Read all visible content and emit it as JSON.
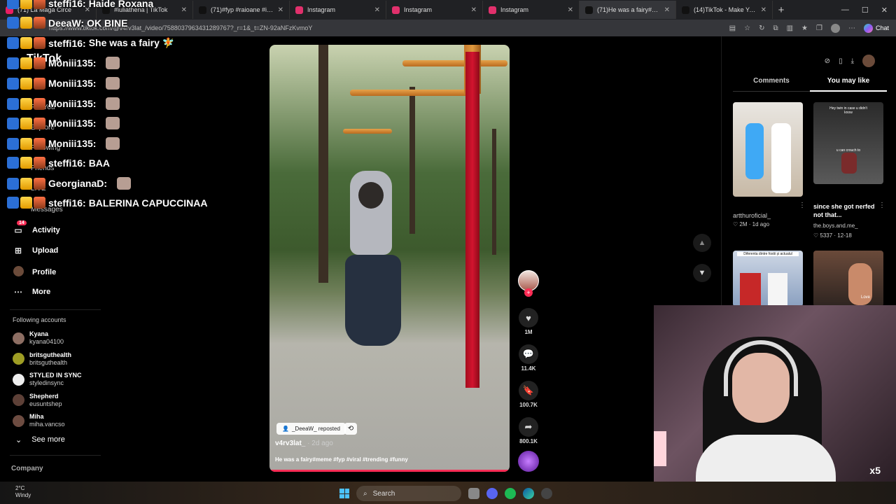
{
  "browser": {
    "tabs": [
      {
        "title": "(71) La Maga Circe",
        "color": "#e91e63"
      },
      {
        "title": "#iuliathena | TikTok",
        "color": "#111111"
      },
      {
        "title": "(71)#fyp #raioane #iulianab",
        "color": "#111111"
      },
      {
        "title": "Instagram",
        "color": "#e1306c"
      },
      {
        "title": "Instagram",
        "color": "#e1306c"
      },
      {
        "title": "Instagram",
        "color": "#e1306c"
      },
      {
        "title": "(71)He was a fairy#meme",
        "color": "#111111",
        "active": true
      },
      {
        "title": "(14)TikTok - Make Your",
        "color": "#111111"
      }
    ],
    "url": "https://www.tiktok.com/@v4rv3lat_/video/7588037963431289767?_r=1&_t=ZN-92aNFzKvmoY",
    "chat_label": "Chat"
  },
  "sidebar": {
    "logo": "TikTok",
    "faint_items": [
      "For You",
      "Explore",
      "Following",
      "Friends",
      "LIVE",
      "Messages"
    ],
    "items": [
      {
        "label": "Activity",
        "icon": "activity-icon",
        "badge": "14"
      },
      {
        "label": "Upload",
        "icon": "upload-icon"
      },
      {
        "label": "Profile",
        "icon": "profile-icon"
      },
      {
        "label": "More",
        "icon": "more-icon"
      }
    ],
    "following_heading": "Following accounts",
    "accounts": [
      {
        "name": "Kyana",
        "handle": "kyana04100",
        "color": "#8d6e63"
      },
      {
        "name": "britsguthealth",
        "handle": "britsguthealth",
        "color": "#9e9d24"
      },
      {
        "name": "STYLED IN SYNC",
        "handle": "styledinsync",
        "color": "#eeeeee"
      },
      {
        "name": "Shepherd",
        "handle": "eusuntshep",
        "color": "#5d4037"
      },
      {
        "name": "Miha",
        "handle": "miha.vancso",
        "color": "#6d4c41"
      }
    ],
    "see_more": "See more",
    "company": "Company"
  },
  "chat": [
    {
      "user": "steffi16:",
      "msg": "Haide Roxana"
    },
    {
      "user": "DeeaW:",
      "msg": "OK BINE"
    },
    {
      "user": "steffi16:",
      "msg": "She was a fairy 🧚"
    },
    {
      "user": "Moniii135:",
      "msg": "",
      "emote": true
    },
    {
      "user": "Moniii135:",
      "msg": "",
      "emote": true
    },
    {
      "user": "Moniii135:",
      "msg": "",
      "emote": true
    },
    {
      "user": "Moniii135:",
      "msg": "",
      "emote": true
    },
    {
      "user": "Moniii135:",
      "msg": "",
      "emote": true
    },
    {
      "user": "steffi16:",
      "msg": "BAA"
    },
    {
      "user": "GeorgianaD:",
      "msg": "",
      "emote": true
    },
    {
      "user": "steffi16:",
      "msg": "BALERINA CAPUCCINAA"
    }
  ],
  "video": {
    "reposted": "_DeeaW_ reposted",
    "author": "v4rv3lat_",
    "date": "· 2d ago",
    "caption": "He was a fairy#meme #fyp #viral #trending #funny",
    "progress_percent": 100
  },
  "actions": {
    "likes": "1M",
    "comments": "11.4K",
    "saves": "100.7K",
    "shares": "800.1K"
  },
  "right_panel": {
    "tabs": [
      "Comments",
      "You may like"
    ],
    "recs": [
      {
        "caption": "artthuroficial_",
        "meta": "♡ 2M · 1d ago"
      },
      {
        "caption": "since she got nerfed not that...",
        "author": "the.boys.and.me_",
        "meta": "♡ 5337 · 12-18",
        "thumb_text": "Hey twin in case u didn't know",
        "thumb_sub": "u can crouch to"
      }
    ],
    "thumb3_text": "Diferenta dintre fostii și actualul",
    "thumb4_text": "Love"
  },
  "cam": {
    "overlay": "x5"
  },
  "taskbar": {
    "temp": "2°C",
    "weather": "Windy",
    "search": "Search"
  }
}
